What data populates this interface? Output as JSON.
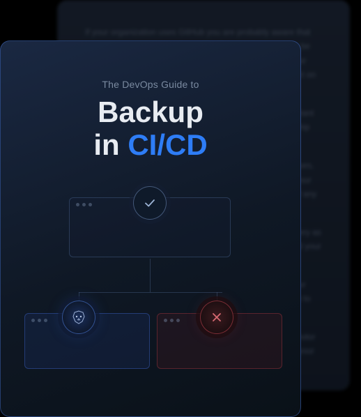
{
  "front": {
    "subtitle": "The DevOps Guide to",
    "title_line1": "Backup",
    "title_line2_pre": "in ",
    "title_line2_accent": "CI/CD"
  },
  "back": {
    "p1": "If your organization uses GitHub you are probably aware that code as well as the rest of your DevOps pipeline needs to be protected — you rely on it every day. In the event of a major outage or data loss, recovery can take days and the impact on productivity and your organization can be significant.",
    "p2": "Your source code repositories are among your most important assets and their availability directly affects your ability to ship software and respond to incidents.",
    "p3": "Backing up GitHub data isn't just about the code itself. Issues, pull requests, wikis, releases, and the metadata that ties your workflow together are equally critical and should be part of any complete backup strategy.",
    "p4": "In this guide we cover how to approach backup and recovery as an integral part of your CI/CD pipeline — so your team and your company can keep moving even when things go wrong.",
    "p5": "We also look at common pitfalls and how to make sure your restores actually work when you need them, including how to test backups routinely.",
    "p6": "Finally we discuss tooling choices and how to evaluate vendor solutions so you can pick the option that best fits the way your teams already work."
  }
}
